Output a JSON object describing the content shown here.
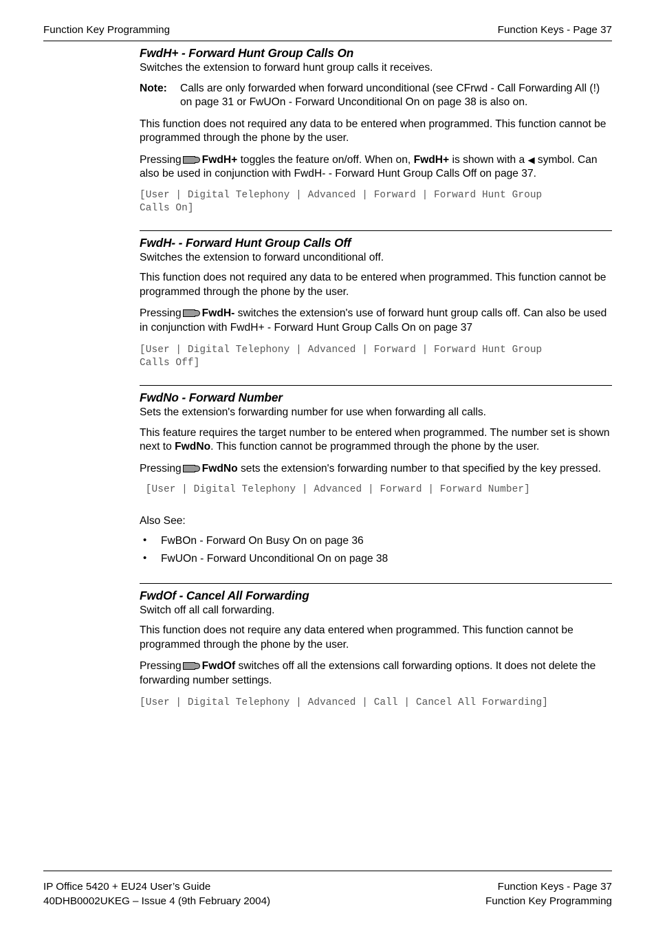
{
  "header": {
    "left": "Function Key Programming",
    "right": "Function Keys - Page 37"
  },
  "icons": {
    "feature_key": "phone-feature-key-icon",
    "triangle_left": "◀",
    "bullet": "•"
  },
  "sections": [
    {
      "id": "fwdh-plus",
      "has_rule": false,
      "title": "FwdH+ - Forward Hunt Group Calls On",
      "intro": "Switches the extension to forward hunt group calls it receives.",
      "note_label": "Note:",
      "note_body": "Calls are only forwarded when forward unconditional (see CFrwd - Call Forwarding All (!) on page 31 or FwUOn - Forward Unconditional On on page 38 is also on.",
      "para2": "This function does not required any data to be entered when programmed. This function cannot be programmed through the phone by the user.",
      "pressing_prefix": "Pressing",
      "pressing_bold1": "FwdH+",
      "pressing_mid1": "toggles the feature on/off. When on,",
      "pressing_bold2": "FwdH+",
      "pressing_mid2": "is shown with a",
      "pressing_tail": "symbol. Can also be used in conjunction with FwdH- - Forward Hunt Group Calls Off on page 37.",
      "code": "[User | Digital Telephony | Advanced | Forward | Forward Hunt Group\nCalls On]"
    },
    {
      "id": "fwdh-minus",
      "has_rule": true,
      "title": "FwdH- - Forward Hunt Group Calls Off",
      "intro": "Switches the extension to forward unconditional off.",
      "para2": "This function does not required any data to be entered when programmed. This function cannot be programmed through the phone by the user.",
      "pressing_prefix": "Pressing",
      "pressing_bold1": "FwdH-",
      "pressing_tail": "switches the extension's use of forward hunt group calls off. Can also be used in conjunction with FwdH+ - Forward Hunt Group Calls On on page 37",
      "code": "[User | Digital Telephony | Advanced | Forward | Forward Hunt Group\nCalls Off]"
    },
    {
      "id": "fwdno",
      "has_rule": true,
      "title": "FwdNo - Forward Number",
      "intro": "Sets the extension's forwarding number for use when forwarding all calls.",
      "para2_pre": "This feature requires the target number to be entered when programmed. The number set is shown next to",
      "para2_bold": "FwdNo",
      "para2_post": ". This function cannot be programmed through the phone by the user.",
      "pressing_prefix": "Pressing",
      "pressing_bold1": "FwdNo",
      "pressing_tail": "sets the extension's forwarding number to that specified by the key pressed.",
      "code": " [User | Digital Telephony | Advanced | Forward | Forward Number]",
      "alsosee_title": "Also See:",
      "alsosee_items": [
        "FwBOn - Forward On Busy On on page 36",
        "FwUOn - Forward Unconditional On on page 38"
      ]
    },
    {
      "id": "fwdof",
      "has_rule": true,
      "title": "FwdOf - Cancel All Forwarding",
      "intro": "Switch off all call forwarding.",
      "para2": "This function does not require any data entered when programmed. This function cannot be programmed through the phone by the user.",
      "pressing_prefix": "Pressing",
      "pressing_bold1": "FwdOf",
      "pressing_tail": "switches off all the extensions call forwarding options. It does not delete the forwarding number settings.",
      "code": "[User | Digital Telephony | Advanced | Call | Cancel All Forwarding]"
    }
  ],
  "footer": {
    "left_line1": "IP Office 5420 + EU24 User’s Guide",
    "left_line2": "40DHB0002UKEG – Issue 4 (9th February 2004)",
    "right_line1": "Function Keys - Page 37",
    "right_line2": "Function Key Programming"
  }
}
